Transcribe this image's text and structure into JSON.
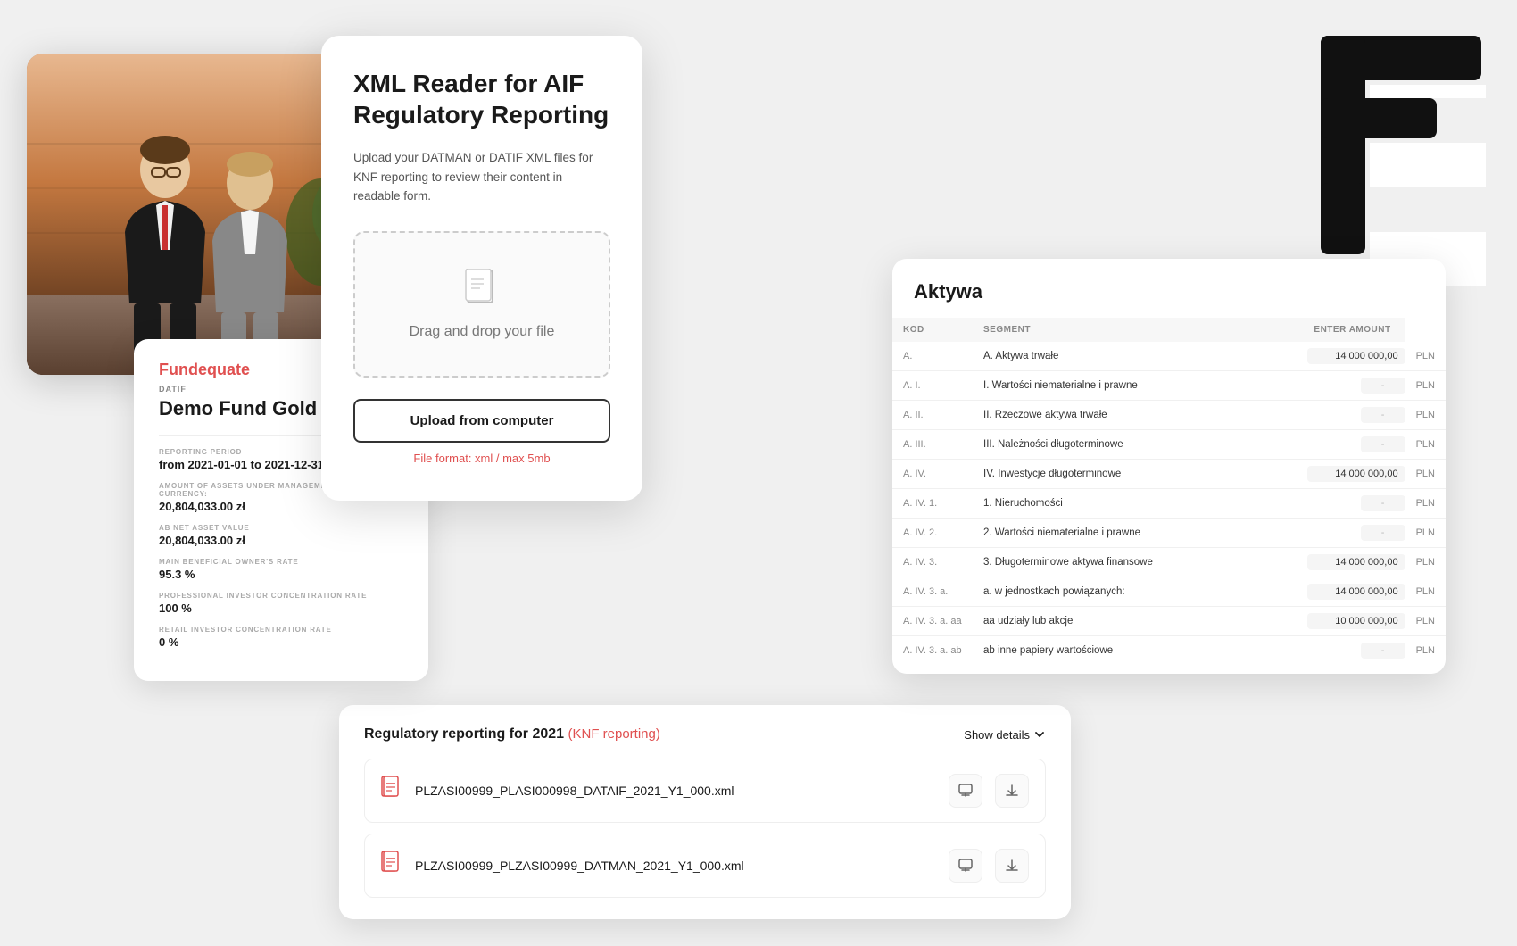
{
  "xmlReader": {
    "title": "XML Reader for AIF Regulatory Reporting",
    "subtitle": "Upload your DATMAN or DATIF XML files for KNF reporting to review their content in readable form.",
    "dropZone": {
      "text": "Drag and drop your file",
      "iconSymbol": "📄"
    },
    "uploadButton": "Upload from computer",
    "fileFormat": "File format: xml / max 5mb"
  },
  "fund": {
    "logoText": "Fund",
    "logoAccent": "equate",
    "tag": "DATIF",
    "name": "Demo Fund Gold ASI",
    "reportingPeriodLabel": "REPORTING PERIOD",
    "reportingPeriod": "from  2021-01-01  to  2021-12-31",
    "assetsLabel": "AMOUNT OF ASSETS UNDER MANAGEMENT IN THE BASE CURRENCY:",
    "assetsValue": "20,804,033.00 zł",
    "navLabel": "AB NET ASSET VALUE",
    "navValue": "20,804,033.00 zł",
    "mainBenefLabel": "MAIN BENEFICIAL OWNER'S RATE",
    "mainBenefValue": "95.3 %",
    "profInvLabel": "PROFESSIONAL INVESTOR CONCENTRATION RATE",
    "profInvValue": "100 %",
    "retailInvLabel": "RETAIL INVESTOR CONCENTRATION RATE",
    "retailInvValue": "0 %"
  },
  "aktywa": {
    "title": "Aktywa",
    "columns": [
      "KOD",
      "SEGMENT",
      "ENTER AMOUNT"
    ],
    "rows": [
      {
        "kod": "A.",
        "segment": "A. Aktywa trwałe",
        "amount": "14 000 000,00",
        "currency": "PLN",
        "hasAmount": true
      },
      {
        "kod": "A. I.",
        "segment": "I. Wartości niematerialne i prawne",
        "amount": "-",
        "currency": "PLN",
        "hasAmount": false
      },
      {
        "kod": "A. II.",
        "segment": "II. Rzeczowe aktywa trwałe",
        "amount": "-",
        "currency": "PLN",
        "hasAmount": false
      },
      {
        "kod": "A. III.",
        "segment": "III. Należności długoterminowe",
        "amount": "-",
        "currency": "PLN",
        "hasAmount": false
      },
      {
        "kod": "A. IV.",
        "segment": "IV. Inwestycje długoterminowe",
        "amount": "14 000 000,00",
        "currency": "PLN",
        "hasAmount": true
      },
      {
        "kod": "A. IV. 1.",
        "segment": "1. Nieruchomości",
        "amount": "-",
        "currency": "PLN",
        "hasAmount": false
      },
      {
        "kod": "A. IV. 2.",
        "segment": "2. Wartości niematerialne i prawne",
        "amount": "-",
        "currency": "PLN",
        "hasAmount": false
      },
      {
        "kod": "A. IV. 3.",
        "segment": "3. Długoterminowe aktywa finansowe",
        "amount": "14 000 000,00",
        "currency": "PLN",
        "hasAmount": true
      },
      {
        "kod": "A. IV. 3. a.",
        "segment": "a. w jednostkach powiązanych:",
        "amount": "14 000 000,00",
        "currency": "PLN",
        "hasAmount": true
      },
      {
        "kod": "A. IV. 3. a. aa",
        "segment": "aa udziały lub akcje",
        "amount": "10 000 000,00",
        "currency": "PLN",
        "hasAmount": true
      },
      {
        "kod": "A. IV. 3. a. ab",
        "segment": "ab inne papiery wartościowe",
        "amount": "-",
        "currency": "PLN",
        "hasAmount": false
      }
    ]
  },
  "regulatory": {
    "title": "Regulatory reporting for 2021",
    "badge": "(KNF reporting)",
    "showDetails": "Show details",
    "files": [
      {
        "name": "PLZASI00999_PLASI000998_DATAIF_2021_Y1_000.xml",
        "iconSymbol": "📄"
      },
      {
        "name": "PLZASI00999_PLZASI00999_DATMAN_2021_Y1_000.xml",
        "iconSymbol": "📄"
      }
    ]
  },
  "colors": {
    "red": "#e05050",
    "dark": "#1a1a1a",
    "gray": "#888888",
    "lightGray": "#f5f5f5"
  }
}
